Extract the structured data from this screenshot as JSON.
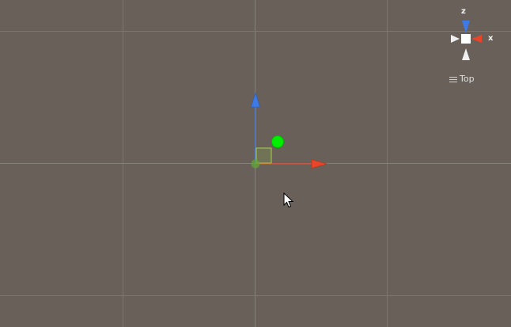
{
  "scene_view": {
    "orientation_gizmo": {
      "axis_z_label": "z",
      "axis_x_label": "x",
      "view_label": "Top",
      "view_menu_icon": "hamburger-menu-icon"
    },
    "handles": {
      "y_axis_color": "#3d7ae6",
      "x_axis_color": "#e8452a",
      "center_color": "#5fa53a",
      "rect_handle_color": "#a3d24a",
      "selected_object_color": "#00ee00"
    },
    "grid": {
      "background_color": "#696159",
      "line_color": "#7d7670"
    },
    "cursor": "arrow-cursor-icon"
  }
}
